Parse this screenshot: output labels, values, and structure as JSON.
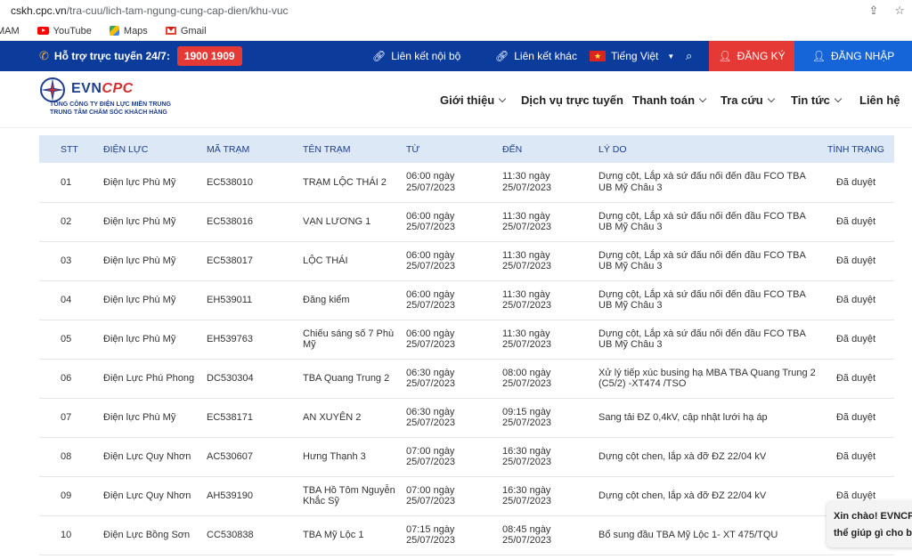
{
  "browser": {
    "url_domain": "cskh.cpc.vn",
    "url_path": "/tra-cuu/lich-tam-ngung-cung-cap-dien/khu-vuc"
  },
  "bookmarks": [
    {
      "label": "MAM",
      "icon": "none"
    },
    {
      "label": "YouTube",
      "icon": "youtube-icon"
    },
    {
      "label": "Maps",
      "icon": "maps-icon"
    },
    {
      "label": "Gmail",
      "icon": "gmail-icon"
    }
  ],
  "topbar": {
    "support_label": "Hỗ trợ trực tuyến 24/7:",
    "hotline": "1900 1909",
    "internal_link": "Liên kết nội bộ",
    "other_link": "Liên kết khác",
    "language": "Tiếng Việt",
    "register": "ĐĂNG KÝ",
    "login": "ĐĂNG NHẬP"
  },
  "header": {
    "brand_evn": "EVN",
    "brand_cpc": "CPC",
    "org_line1": "TỔNG CÔNG TY ĐIỆN LỰC MIỀN TRUNG",
    "org_line2": "TRUNG TÂM CHĂM SÓC KHÁCH HÀNG"
  },
  "nav": [
    {
      "label": "Giới thiệu",
      "dropdown": true
    },
    {
      "label": "Dịch vụ trực tuyến",
      "dropdown": false
    },
    {
      "label": "Thanh toán",
      "dropdown": true
    },
    {
      "label": "Tra cứu",
      "dropdown": true
    },
    {
      "label": "Tin tức",
      "dropdown": true
    },
    {
      "label": "Liên hệ",
      "dropdown": false
    }
  ],
  "table": {
    "headers": [
      "STT",
      "ĐIỆN LỰC",
      "MÃ TRẠM",
      "TÊN TRẠM",
      "TỪ",
      "ĐẾN",
      "LÝ DO",
      "TÌNH TRẠNG"
    ],
    "rows": [
      [
        "01",
        "Điện lực Phù Mỹ",
        "EC538010",
        "TRẠM LỘC THÁI 2",
        "06:00 ngày 25/07/2023",
        "11:30 ngày 25/07/2023",
        "Dựng cột, Lắp xà sứ đấu nối đến đầu FCO TBA UB Mỹ Châu 3",
        "Đã duyệt"
      ],
      [
        "02",
        "Điện lực Phù Mỹ",
        "EC538016",
        "VẠN LƯƠNG 1",
        "06:00 ngày 25/07/2023",
        "11:30 ngày 25/07/2023",
        "Dựng cột, Lắp xà sứ đấu nối đến đầu FCO TBA UB Mỹ Châu 3",
        "Đã duyệt"
      ],
      [
        "03",
        "Điện lực Phù Mỹ",
        "EC538017",
        "LỘC THÁI",
        "06:00 ngày 25/07/2023",
        "11:30 ngày 25/07/2023",
        "Dựng cột, Lắp xà sứ đấu nối đến đầu FCO TBA UB Mỹ Châu 3",
        "Đã duyệt"
      ],
      [
        "04",
        "Điện lực Phù Mỹ",
        "EH539011",
        "Đăng kiểm",
        "06:00 ngày 25/07/2023",
        "11:30 ngày 25/07/2023",
        "Dựng cột, Lắp xà sứ đấu nối đến đầu FCO TBA UB Mỹ Châu 3",
        "Đã duyệt"
      ],
      [
        "05",
        "Điện lực Phù Mỹ",
        "EH539763",
        "Chiếu sáng số 7 Phù Mỹ",
        "06:00 ngày 25/07/2023",
        "11:30 ngày 25/07/2023",
        "Dựng cột, Lắp xà sứ đấu nối đến đầu FCO TBA UB Mỹ Châu 3",
        "Đã duyệt"
      ],
      [
        "06",
        "Điện Lực Phú Phong",
        "DC530304",
        "TBA Quang Trung 2",
        "06:30 ngày 25/07/2023",
        "08:00 ngày 25/07/2023",
        "Xử lý tiếp xúc busing hạ MBA TBA Quang Trung 2 (C5/2) -XT474 /TSO",
        "Đã duyệt"
      ],
      [
        "07",
        "Điện lực Phù Mỹ",
        "EC538171",
        "AN XUYÊN 2",
        "06:30 ngày 25/07/2023",
        "09:15 ngày 25/07/2023",
        "Sang tải ĐZ 0,4kV, cập nhật lưới hạ áp",
        "Đã duyệt"
      ],
      [
        "08",
        "Điện Lực Quy Nhơn",
        "AC530607",
        "Hưng Thạnh 3",
        "07:00 ngày 25/07/2023",
        "16:30 ngày 25/07/2023",
        "Dựng cột chen, lắp xà đỡ ĐZ 22/04 kV",
        "Đã duyệt"
      ],
      [
        "09",
        "Điện Lực Quy Nhơn",
        "AH539190",
        "TBA Hồ Tôm Nguyễn Khắc Sỹ",
        "07:00 ngày 25/07/2023",
        "16:30 ngày 25/07/2023",
        "Dựng cột chen, lắp xà đỡ ĐZ 22/04 kV",
        "Đã duyệt"
      ],
      [
        "10",
        "Điện Lực Bồng Sơn",
        "CC530838",
        "TBA Mỹ Lộc 1",
        "07:15 ngày 25/07/2023",
        "08:45 ngày 25/07/2023",
        "Bổ sung đầu TBA Mỹ Lộc 1- XT 475/TQU",
        ""
      ]
    ]
  },
  "chat": {
    "line1": "Xin chào! EVNCPC",
    "line2": "thể giúp gì cho bạ"
  },
  "colors": {
    "topbar": "#0b3c9c",
    "register": "#e53935",
    "login": "#1565d8",
    "header_row": "#dde8f6"
  }
}
